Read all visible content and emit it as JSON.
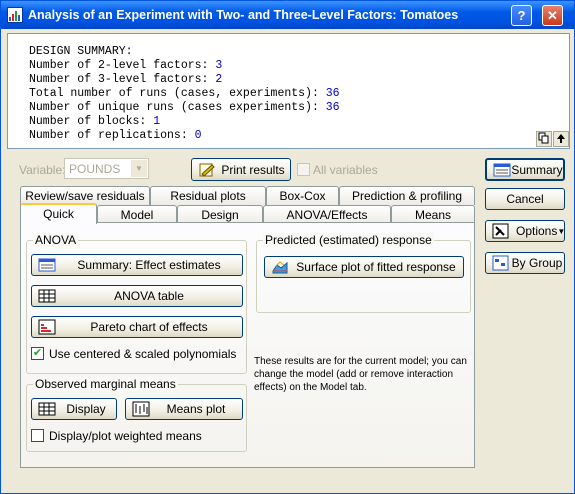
{
  "window": {
    "title": "Analysis of an Experiment with Two- and Three-Level Factors: Tomatoes",
    "help_glyph": "?",
    "close_glyph": "✕"
  },
  "summary": {
    "lines": [
      {
        "label": "DESIGN SUMMARY:",
        "value": ""
      },
      {
        "label": "Number of 2-level factors: ",
        "value": "3"
      },
      {
        "label": "Number of 3-level factors: ",
        "value": "2"
      },
      {
        "label": "Total number of runs (cases, experiments): ",
        "value": "36"
      },
      {
        "label": "Number of unique runs (cases experiments): ",
        "value": "36"
      },
      {
        "label": "Number of blocks: ",
        "value": "1"
      },
      {
        "label": "Number of replications: ",
        "value": "0"
      }
    ]
  },
  "toolbar": {
    "variable_label": "Variable:",
    "variable_value": "POUNDS",
    "print_results": "Print results",
    "all_variables": "All variables"
  },
  "right_buttons": {
    "summary": "Summary",
    "cancel": "Cancel",
    "options": "Options",
    "by_group": "By Group"
  },
  "tabs_back": [
    "Review/save residuals",
    "Residual plots",
    "Box-Cox",
    "Prediction & profiling"
  ],
  "tabs_front": [
    "Quick",
    "Model",
    "Design",
    "ANOVA/Effects",
    "Means"
  ],
  "anova": {
    "legend": "ANOVA",
    "summary_effects": "Summary:  Effect estimates",
    "anova_table": "ANOVA table",
    "pareto": "Pareto chart of effects",
    "centered_scaled": "Use centered & scaled polynomials",
    "centered_checked": true
  },
  "predicted": {
    "legend": "Predicted (estimated) response",
    "surface_plot": "Surface plot of fitted response"
  },
  "note": "These results are for the current model; you can change the model (add or remove interaction effects) on the Model tab.",
  "means": {
    "legend": "Observed marginal means",
    "display": "Display",
    "means_plot": "Means plot",
    "weighted": "Display/plot weighted means"
  },
  "colors": {
    "titlebar": "#0054e3",
    "value_blue": "#0000c0",
    "active_tab_highlight": "#ffc83c"
  }
}
